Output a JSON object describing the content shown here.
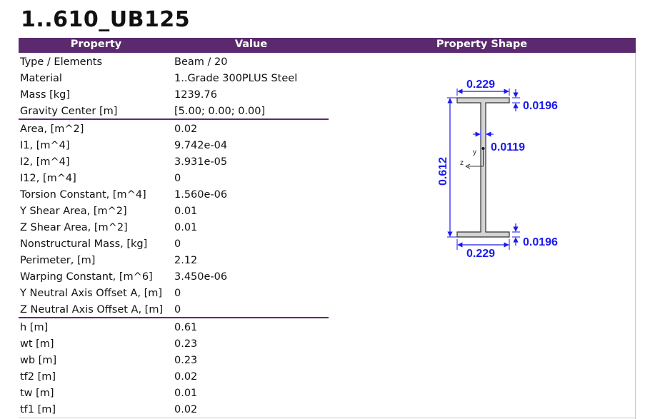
{
  "title": "1..610_UB125",
  "header": {
    "property": "Property",
    "value": "Value",
    "shape": "Property Shape"
  },
  "groups": [
    [
      {
        "key": "Type / Elements",
        "value": "Beam / 20"
      },
      {
        "key": "Material",
        "value": "1..Grade 300PLUS Steel"
      },
      {
        "key": "Mass [kg]",
        "value": "1239.76"
      },
      {
        "key": "Gravity Center [m]",
        "value": "[5.00; 0.00; 0.00]"
      }
    ],
    [
      {
        "key": "Area, [m^2]",
        "value": "0.02"
      },
      {
        "key": "I1, [m^4]",
        "value": "9.742e-04"
      },
      {
        "key": "I2, [m^4]",
        "value": "3.931e-05"
      },
      {
        "key": "I12, [m^4]",
        "value": "0"
      },
      {
        "key": "Torsion Constant, [m^4]",
        "value": "1.560e-06"
      },
      {
        "key": "Y Shear Area, [m^2]",
        "value": "0.01"
      },
      {
        "key": "Z Shear Area, [m^2]",
        "value": "0.01"
      },
      {
        "key": "Nonstructural Mass, [kg]",
        "value": "0"
      },
      {
        "key": "Perimeter, [m]",
        "value": "2.12"
      },
      {
        "key": "Warping Constant, [m^6]",
        "value": "3.450e-06"
      },
      {
        "key": "Y Neutral Axis Offset A, [m]",
        "value": "0"
      },
      {
        "key": "Z Neutral Axis Offset A, [m]",
        "value": "0"
      }
    ],
    [
      {
        "key": "h [m]",
        "value": "0.61"
      },
      {
        "key": "wt [m]",
        "value": "0.23"
      },
      {
        "key": "wb [m]",
        "value": "0.23"
      },
      {
        "key": "tf2 [m]",
        "value": "0.02"
      },
      {
        "key": "tw [m]",
        "value": "0.01"
      },
      {
        "key": "tf1 [m]",
        "value": "0.02"
      }
    ]
  ],
  "shape": {
    "top_width": "0.229",
    "bottom_width": "0.229",
    "top_flange": "0.0196",
    "bottom_flange": "0.0196",
    "web": "0.0119",
    "height": "0.612",
    "axis_y": "y",
    "axis_z": "z",
    "colors": {
      "dimension": "#1a1aee",
      "header": "#5b2a6e",
      "section_fill": "#d4d4d4"
    }
  }
}
